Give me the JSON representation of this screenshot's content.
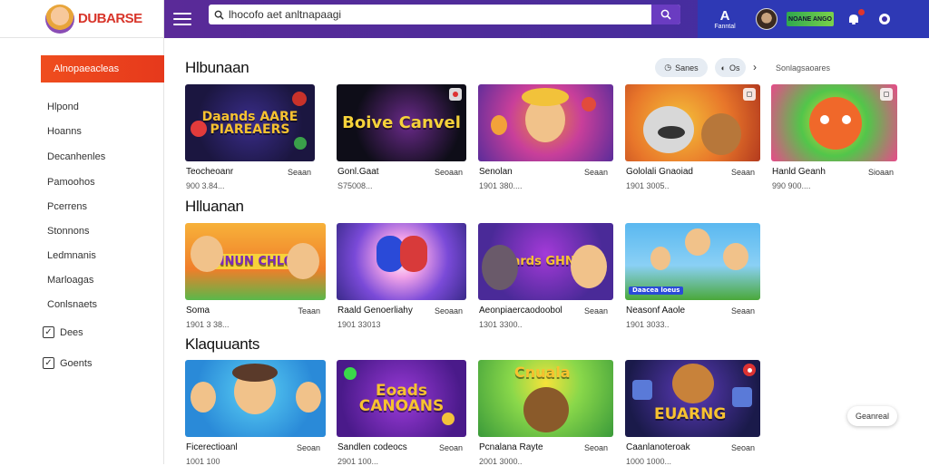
{
  "header": {
    "brand_name": "DUBARSE",
    "search_value": "lhocofo aet anltnapaagi",
    "nav_a_label": "A",
    "nav_a_sub": "Fanntal",
    "promo_label": "NOANE ANGO"
  },
  "sidebar": {
    "cta_label": "Alnopaeacleas",
    "items": [
      "Hlpond",
      "Hoanns",
      "Decanhenles",
      "Pamoohos",
      "Pcerrens",
      "Stonnons",
      "Ledmnanis",
      "Marloagas",
      "Conlsnaets"
    ],
    "checks": [
      "Dees",
      "Goents"
    ]
  },
  "main": {
    "chips": [
      "Sanes",
      "Os"
    ],
    "sort_label": "Sonlagsaoares",
    "sections": [
      {
        "title": "Hlbunaan",
        "cards": [
          {
            "thumb_text": "Daands AARE PIAREAERS",
            "title": "Teocheoanr",
            "tag": "Seaan",
            "meta": "900 3.84..."
          },
          {
            "thumb_text": "Boive Canvel",
            "title": "Gonl.Gaat",
            "tag": "Seoaan",
            "meta": "S75008..."
          },
          {
            "thumb_text": "",
            "title": "Senolan",
            "tag": "Seaan",
            "meta": "1901 380...."
          },
          {
            "thumb_text": "",
            "title": "Gololali Gnaoiad",
            "tag": "Seaan",
            "meta": "1901 3005.."
          },
          {
            "thumb_text": "",
            "title": "Hanld Geanh",
            "tag": "Sioaan",
            "meta": "990 900...."
          }
        ]
      },
      {
        "title": "Hlluanan",
        "cards": [
          {
            "thumb_text": "HINNUN CHLOES",
            "title": "Soma",
            "tag": "Teaan",
            "meta": "1901 3 38..."
          },
          {
            "thumb_text": "",
            "title": "Raald Genoerliahy",
            "tag": "Seoaan",
            "meta": "1901 33013"
          },
          {
            "thumb_text": "Daards GHNOIL",
            "title": "Aeonpiaercaodoobol",
            "tag": "Seaan",
            "meta": "1301 3300.."
          },
          {
            "thumb_text": "Daacea loeus",
            "title": "Neasonf Aaole",
            "tag": "Seaan",
            "meta": "1901 3033.."
          }
        ]
      },
      {
        "title": "Klaquuants",
        "cards": [
          {
            "thumb_text": "",
            "title": "Ficerectioanl",
            "tag": "Seoan",
            "meta": "1001 100"
          },
          {
            "thumb_text": "Eoads CANOANS",
            "title": "Sandlen codeocs",
            "tag": "Seoan",
            "meta": "2901 100..."
          },
          {
            "thumb_text": "Cnuala",
            "title": "Pcnalana Rayte",
            "tag": "Seoan",
            "meta": "2001 3000.."
          },
          {
            "thumb_text": "EUARNG",
            "title": "Caanlanoteroak",
            "tag": "Seoan",
            "meta": "1000 1000..."
          }
        ]
      }
    ]
  },
  "float_button_label": "Geanreal",
  "colors": {
    "header_purple": "#4b2d9b",
    "header_blue": "#2e39b5",
    "cta_orange": "#ea431e",
    "search_button": "#6a3cc1"
  }
}
